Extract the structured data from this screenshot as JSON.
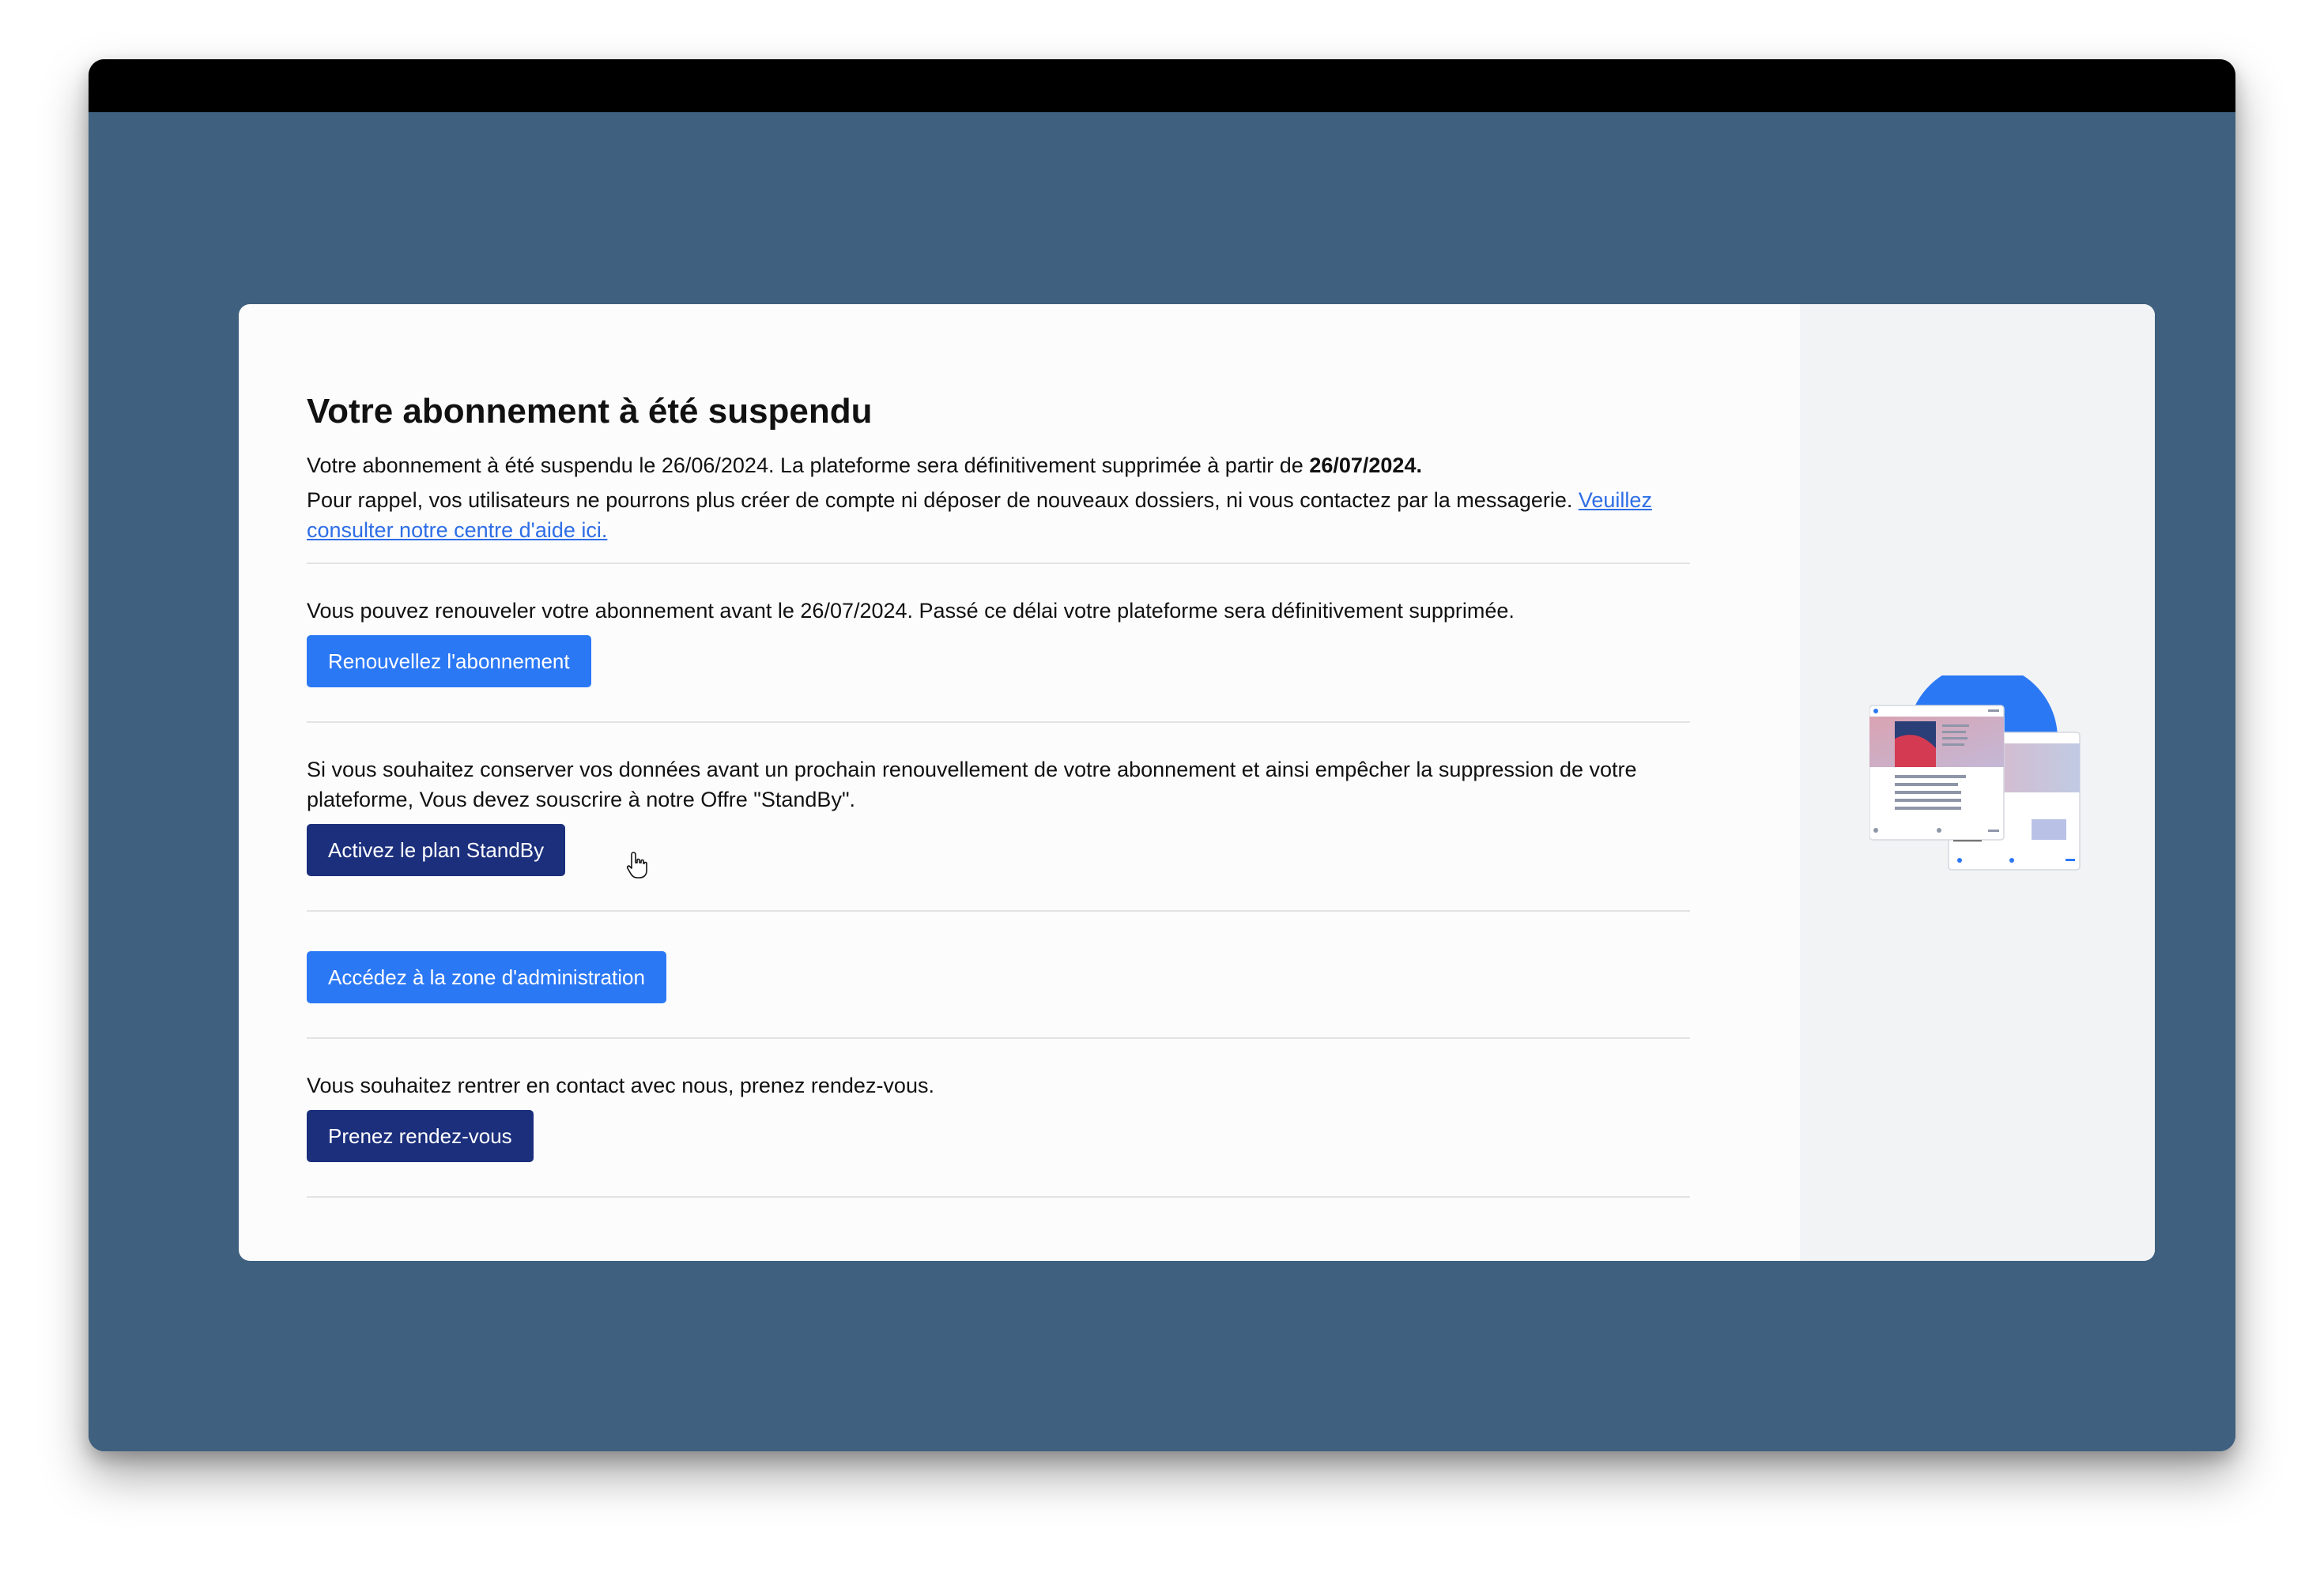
{
  "page": {
    "title": "Votre abonnement à été suspendu",
    "intro_line1_prefix": "Votre abonnement à été suspendu le 26/06/2024. La plateforme sera définitivement supprimée à partir de ",
    "intro_line1_date": "26/07/2024.",
    "intro_line2_prefix": "Pour rappel, vos utilisateurs ne pourrons plus créer de compte ni déposer de nouveaux dossiers, ni vous contactez par la messagerie. ",
    "help_link": "Veuillez consulter notre centre d'aide ici."
  },
  "sections": {
    "renew": {
      "text": "Vous pouvez renouveler votre abonnement avant le 26/07/2024. Passé ce délai votre plateforme sera définitivement supprimée.",
      "button": "Renouvellez l'abonnement"
    },
    "standby": {
      "text": "Si vous souhaitez conserver vos données avant un prochain renouvellement de votre abonnement et ainsi empêcher la suppression de votre plateforme, Vous devez souscrire à notre Offre \"StandBy\".",
      "button": "Activez le plan StandBy"
    },
    "admin": {
      "button": "Accédez à la zone d'administration"
    },
    "contact": {
      "text": "Vous souhaitez rentrer en contact avec nous, prenez rendez-vous.",
      "button": "Prenez rendez-vous"
    }
  },
  "colors": {
    "background": "#3f607f",
    "titlebar": "#000000",
    "card": "#fcfcfc",
    "aside": "#f2f3f5",
    "primary_button": "#2b78f5",
    "dark_button": "#1b2f7c",
    "link": "#2e6ee6"
  },
  "icons": {
    "cursor": "hand-pointer-icon",
    "illustration": "platform-screens-illustration"
  }
}
